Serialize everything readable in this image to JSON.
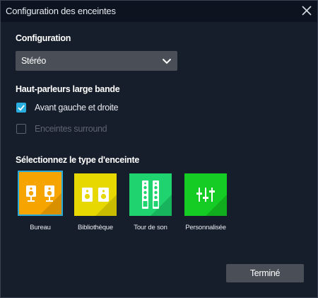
{
  "window": {
    "title": "Configuration des enceintes"
  },
  "config": {
    "label": "Configuration",
    "selected": "Stéréo"
  },
  "wideband": {
    "label": "Haut-parleurs large bande",
    "options": [
      {
        "label": "Avant gauche et droite",
        "checked": true,
        "enabled": true
      },
      {
        "label": "Enceintes surround",
        "checked": false,
        "enabled": false
      }
    ]
  },
  "speaker_type": {
    "label": "Sélectionnez le type d'enceinte",
    "tiles": [
      {
        "label": "Bureau",
        "icon": "desk-speakers-icon",
        "color": "#f5a400",
        "selected": true
      },
      {
        "label": "Bibliothèque",
        "icon": "bookshelf-speakers-icon",
        "color": "#e6d800",
        "selected": false
      },
      {
        "label": "Tour de son",
        "icon": "tower-speakers-icon",
        "color": "#1fd36e",
        "selected": false
      },
      {
        "label": "Personnalisée",
        "icon": "equalizer-sliders-icon",
        "color": "#15cc25",
        "selected": false
      }
    ]
  },
  "footer": {
    "done_label": "Terminé"
  }
}
